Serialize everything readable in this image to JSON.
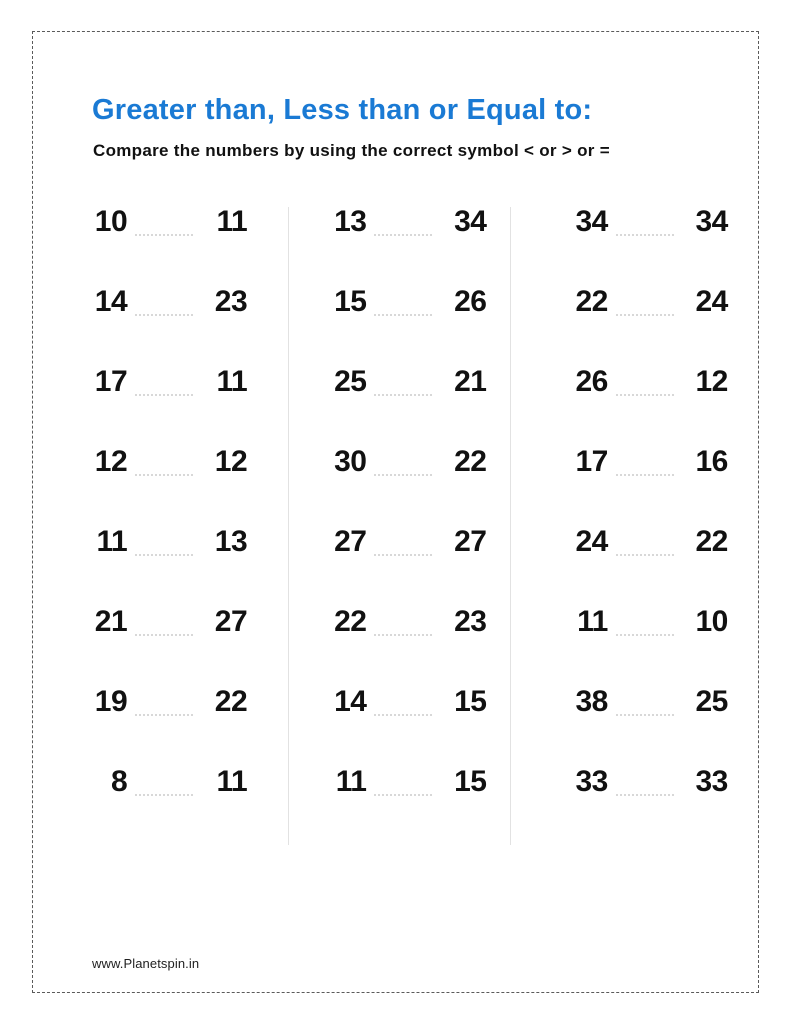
{
  "worksheet": {
    "title": "Greater than, Less than or Equal to:",
    "instruction": "Compare the numbers by using the correct symbol < or > or =",
    "footer": "www.Planetspin.in",
    "title_color": "#1a7ad4",
    "text_color": "#111111",
    "divider_color": "#e2e2e2",
    "blank_line_color": "#d8d8d8",
    "border_color": "#5a5a5a",
    "answer_placeholder": ""
  },
  "columns": [
    {
      "index": 1,
      "rows": [
        {
          "left": "10",
          "right": "11"
        },
        {
          "left": "14",
          "right": "23"
        },
        {
          "left": "17",
          "right": "11"
        },
        {
          "left": "12",
          "right": "12"
        },
        {
          "left": "11",
          "right": "13"
        },
        {
          "left": "21",
          "right": "27"
        },
        {
          "left": "19",
          "right": "22"
        },
        {
          "left": "8",
          "right": "11"
        }
      ]
    },
    {
      "index": 2,
      "rows": [
        {
          "left": "13",
          "right": "34"
        },
        {
          "left": "15",
          "right": "26"
        },
        {
          "left": "25",
          "right": "21"
        },
        {
          "left": "30",
          "right": "22"
        },
        {
          "left": "27",
          "right": "27"
        },
        {
          "left": "22",
          "right": "23"
        },
        {
          "left": "14",
          "right": "15"
        },
        {
          "left": "11",
          "right": "15"
        }
      ]
    },
    {
      "index": 3,
      "rows": [
        {
          "left": "34",
          "right": "34"
        },
        {
          "left": "22",
          "right": "24"
        },
        {
          "left": "26",
          "right": "12"
        },
        {
          "left": "17",
          "right": "16"
        },
        {
          "left": "24",
          "right": "22"
        },
        {
          "left": "11",
          "right": "10"
        },
        {
          "left": "38",
          "right": "25"
        },
        {
          "left": "33",
          "right": "33"
        }
      ]
    }
  ]
}
